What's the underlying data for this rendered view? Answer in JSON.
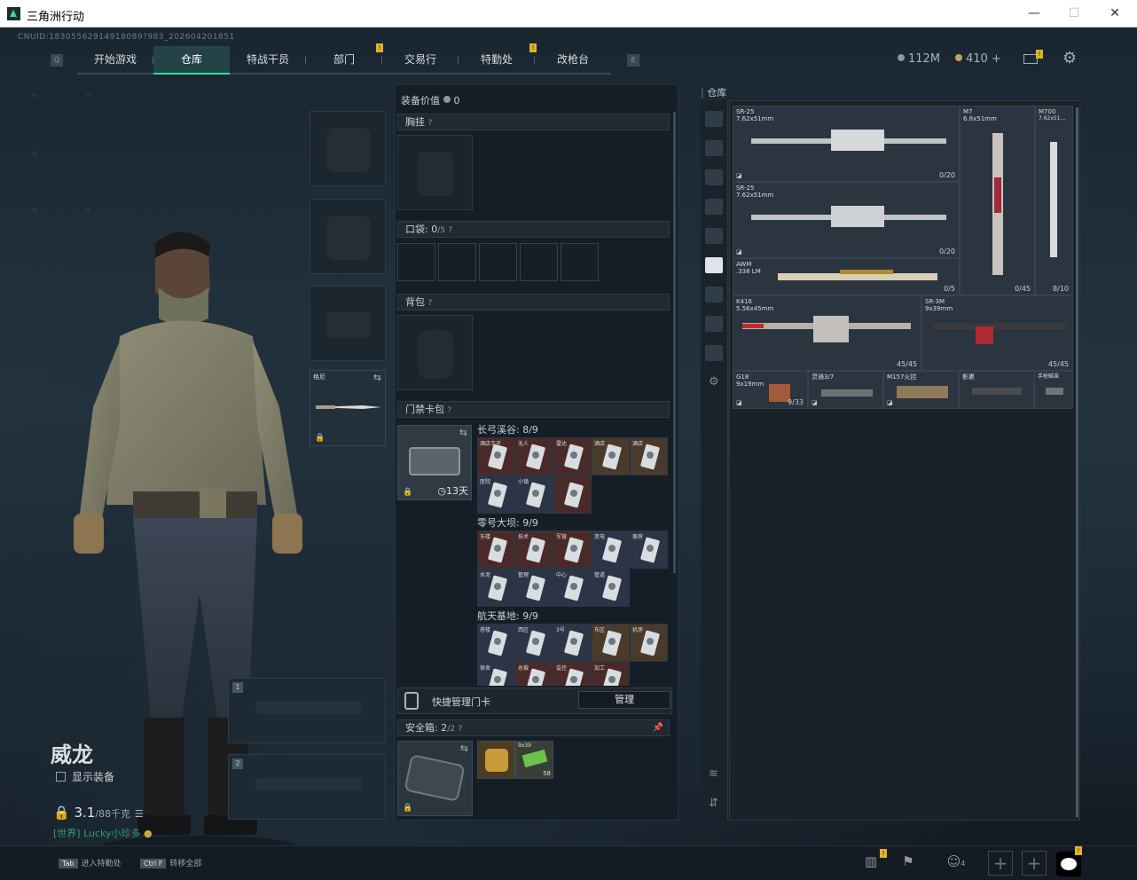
{
  "window": {
    "title": "三角洲行动"
  },
  "uid": "CNUID:18305562914918089?983_202604201851",
  "nav": {
    "tabs": [
      {
        "label": "开始游戏"
      },
      {
        "label": "仓库"
      },
      {
        "label": "特战干员"
      },
      {
        "label": "部门"
      },
      {
        "label": "交易行"
      },
      {
        "label": "特勤处"
      },
      {
        "label": "改枪台"
      }
    ],
    "left_key": "Q",
    "right_key": "E",
    "currency_silver": "112M",
    "currency_gold": "410",
    "plus": "+",
    "badge": "!"
  },
  "operator": {
    "name": "威龙",
    "show_equipment": "显示装备",
    "weight": "3.1",
    "weight_max": "/88千克",
    "chat": "[世界] Lucky小珍多"
  },
  "left_slots": {
    "melee_label": "格尼",
    "weapon1": "1",
    "weapon2": "2"
  },
  "loadout": {
    "value_label": "装备价值",
    "value": "0",
    "chest_rig": "胸挂",
    "pockets_label": "口袋:",
    "pockets_value": "0",
    "pockets_max": "/5",
    "backpack": "背包",
    "keycard_bag": "门禁卡包",
    "keycard_days": "13天",
    "question": "?"
  },
  "key_sections": [
    {
      "title": "长弓溪谷: 8/9",
      "keys": [
        {
          "label": "酒店王子",
          "tone": "red"
        },
        {
          "label": "无人",
          "tone": "red"
        },
        {
          "label": "雷达",
          "tone": "red"
        },
        {
          "label": "酒店",
          "tone": "brown"
        },
        {
          "label": "酒店",
          "tone": "brown"
        },
        {
          "label": "医院",
          "tone": "blue"
        },
        {
          "label": "小镇",
          "tone": "blue"
        },
        {
          "label": "",
          "tone": "red"
        }
      ]
    },
    {
      "title": "零号大坝: 9/9",
      "keys": [
        {
          "label": "东楼",
          "tone": "red"
        },
        {
          "label": "技术",
          "tone": "red"
        },
        {
          "label": "军营",
          "tone": "red"
        },
        {
          "label": "变电",
          "tone": "blue"
        },
        {
          "label": "客房",
          "tone": "blue"
        },
        {
          "label": "水泥",
          "tone": "blue"
        },
        {
          "label": "管理",
          "tone": "blue"
        },
        {
          "label": "中心",
          "tone": "blue"
        },
        {
          "label": "管道",
          "tone": "blue"
        }
      ]
    },
    {
      "title": "航天基地: 9/9",
      "keys": [
        {
          "label": "塔楼",
          "tone": "blue"
        },
        {
          "label": "西区",
          "tone": "blue"
        },
        {
          "label": "3号",
          "tone": "blue"
        },
        {
          "label": "东区",
          "tone": "brown"
        },
        {
          "label": "机房",
          "tone": "brown"
        },
        {
          "label": "宿舍",
          "tone": "blue"
        },
        {
          "label": "总裁",
          "tone": "red"
        },
        {
          "label": "监控",
          "tone": "red"
        },
        {
          "label": "加工",
          "tone": "red"
        }
      ]
    }
  ],
  "quick_manage": {
    "label": "快捷管理门卡",
    "button": "管理"
  },
  "safebox": {
    "label": "安全箱:",
    "value": "2",
    "max": "/2",
    "item2_count": "58",
    "item2_label": "9x39"
  },
  "warehouse": {
    "title": "仓库",
    "guns": [
      {
        "name": "SR-25",
        "caliber": "7.62x51mm",
        "count": "0/20"
      },
      {
        "name": "SR-25",
        "caliber": "7.62x51mm",
        "count": "0/20"
      },
      {
        "name": "M7",
        "caliber": "6.8x51mm",
        "count": "0/45"
      },
      {
        "name": "M700",
        "caliber": "7.62x51...",
        "count": "8/10"
      },
      {
        "name": "AWM",
        "caliber": ".338 LM",
        "count": "0/5"
      },
      {
        "name": "K416",
        "caliber": "5.56x45mm",
        "count": "45/45"
      },
      {
        "name": "SR-3M",
        "caliber": "9x39mm",
        "count": "45/45"
      },
      {
        "name": "G18",
        "caliber": "9x19mm",
        "count": "9/33"
      },
      {
        "name": "灵骑3/7",
        "caliber": "",
        "count": ""
      },
      {
        "name": "M157火控",
        "caliber": "",
        "count": ""
      },
      {
        "name": "影裹",
        "caliber": "",
        "count": ""
      },
      {
        "name": "手枪瞄准",
        "caliber": "",
        "count": ""
      }
    ]
  },
  "bottom": {
    "hint1_key": "Tab",
    "hint1": "进入特勤处",
    "hint2_key": "Ctrl F",
    "hint2": "转移全部",
    "friends": "4",
    "plus": "+"
  },
  "colors": {
    "accent": "#2de09a",
    "badge": "#e3b128",
    "chat": "#2f9b79"
  }
}
